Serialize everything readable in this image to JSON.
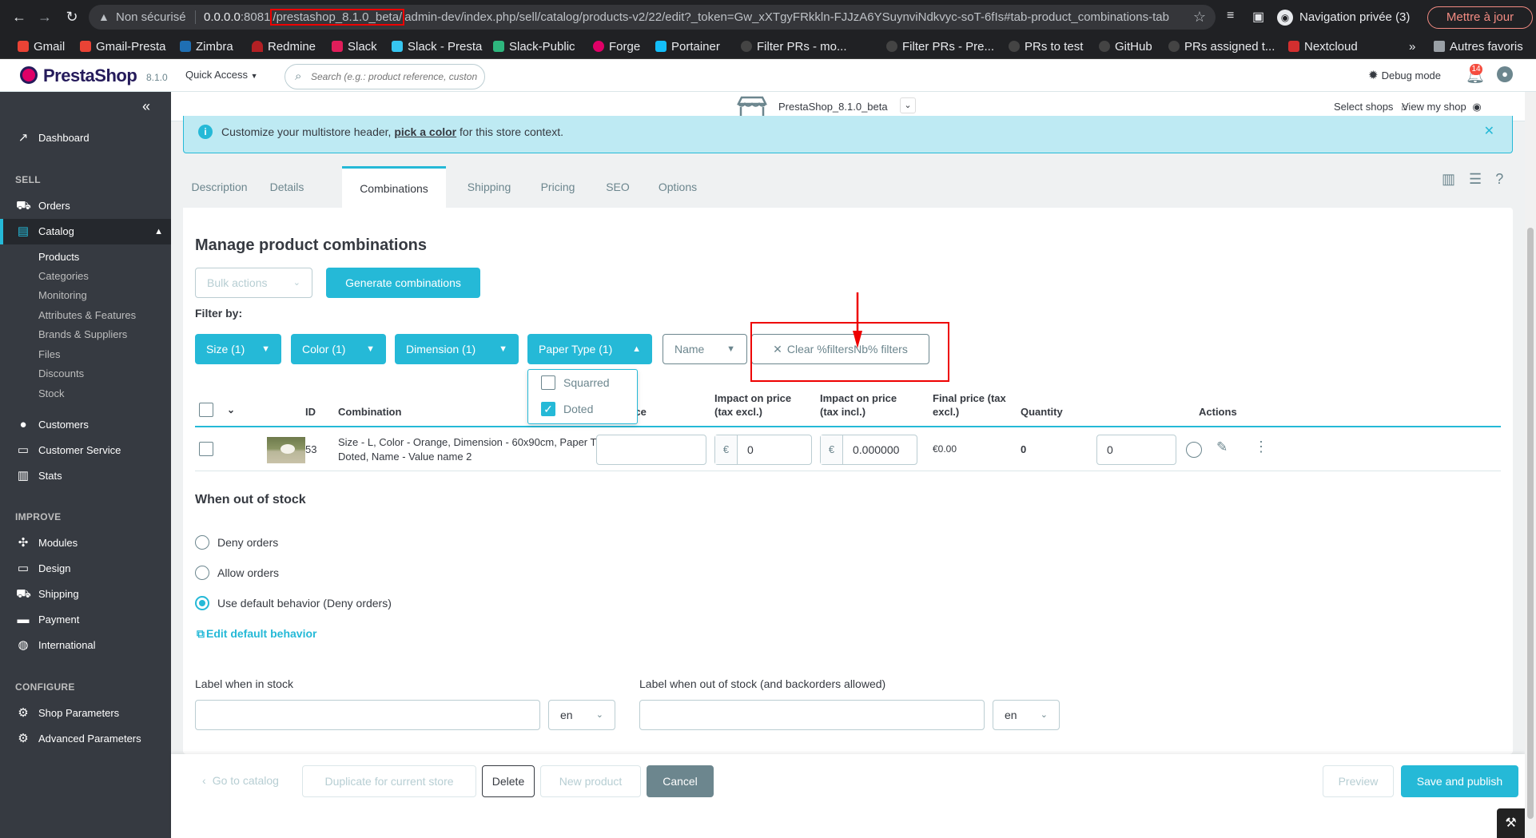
{
  "browser": {
    "not_secure": "Non sécurisé",
    "url_host": "0.0.0.0",
    "url_port": ":8081",
    "url_highlight": "/prestashop_8.1.0_beta/",
    "url_rest": "admin-dev/index.php/sell/catalog/products-v2/22/edit?_token=Gw_xXTgyFRkkln-FJJzA6YSuynviNdkvyc-soT-6fIs#tab-product_combinations-tab",
    "incognito": "Navigation privée (3)",
    "update": "Mettre à jour",
    "bookmarks": [
      "Gmail",
      "Gmail-Presta",
      "Zimbra",
      "Redmine",
      "Slack",
      "Slack - Presta",
      "Slack-Public",
      "Forge",
      "Portainer",
      "Filter PRs - mo...",
      "Filter PRs - Pre...",
      "PRs to test",
      "GitHub",
      "PRs assigned t...",
      "Nextcloud"
    ],
    "more": "»",
    "other_bookmarks": "Autres favoris",
    "colors": {
      "chrome_bg": "#202124",
      "update_accent": "#f28b82"
    }
  },
  "header": {
    "brand": "PrestaShop",
    "version": "8.1.0",
    "quick_access": "Quick Access",
    "search_placeholder": "Search (e.g.: product reference, custon",
    "debug_mode": "Debug mode",
    "notifications_count": "14"
  },
  "sidebar": {
    "dashboard": "Dashboard",
    "sell": "SELL",
    "orders": "Orders",
    "catalog": "Catalog",
    "catalog_sub": [
      "Products",
      "Categories",
      "Monitoring",
      "Attributes & Features",
      "Brands & Suppliers",
      "Files",
      "Discounts",
      "Stock"
    ],
    "customers": "Customers",
    "customer_service": "Customer Service",
    "stats": "Stats",
    "improve": "IMPROVE",
    "modules": "Modules",
    "design": "Design",
    "shipping": "Shipping",
    "payment": "Payment",
    "international": "International",
    "configure": "CONFIGURE",
    "shop_parameters": "Shop Parameters",
    "advanced_parameters": "Advanced Parameters"
  },
  "storebar": {
    "store_name": "PrestaShop_8.1.0_beta",
    "select_shops": "Select shops",
    "view_my_shop": "View my shop"
  },
  "alert": {
    "before": "Customize your multistore header, ",
    "link": "pick a color",
    "after": " for this store context."
  },
  "tabs": [
    "Description",
    "Details",
    "Combinations",
    "Shipping",
    "Pricing",
    "SEO",
    "Options"
  ],
  "combinations": {
    "title": "Manage product combinations",
    "bulk_actions": "Bulk actions",
    "generate": "Generate combinations",
    "filter_by": "Filter by:",
    "filters": [
      "Size (1)",
      "Color (1)",
      "Dimension (1)",
      "Paper Type (1)",
      "Name"
    ],
    "clear_filters": "Clear %filtersNb% filters",
    "paper_type_options": [
      {
        "label": "Squarred",
        "checked": false
      },
      {
        "label": "Doted",
        "checked": true
      }
    ],
    "columns": {
      "id": "ID",
      "combination": "Combination",
      "reference": "Reference",
      "impact_excl_1": "Impact on price",
      "impact_excl_2": "(tax excl.)",
      "impact_incl_1": "Impact on price",
      "impact_incl_2": "(tax incl.)",
      "final_1": "Final price (tax",
      "final_2": "excl.)",
      "quantity": "Quantity",
      "actions": "Actions"
    },
    "rows": [
      {
        "id": "53",
        "combination_1": "Size - L, Color - Orange, Dimension - 60x90cm, Paper Type -",
        "combination_2": "Doted, Name - Value name 2",
        "reference": "",
        "currency": "€",
        "impact_excl": "0",
        "impact_incl": "0.000000",
        "final_price": "€0.00",
        "quantity": "0",
        "quantity_input": "0"
      }
    ]
  },
  "out_of_stock": {
    "title": "When out of stock",
    "options": [
      "Deny orders",
      "Allow orders",
      "Use default behavior (Deny orders)"
    ],
    "selected_index": 2,
    "edit_default": "Edit default behavior",
    "label_in_stock": "Label when in stock",
    "label_out_stock": "Label when out of stock (and backorders allowed)",
    "lang": "en"
  },
  "footer": {
    "go_to_catalog": "Go to catalog",
    "duplicate": "Duplicate for current store",
    "delete": "Delete",
    "new_product": "New product",
    "cancel": "Cancel",
    "preview": "Preview",
    "save_publish": "Save and publish"
  },
  "colors": {
    "primary": "#25b9d7",
    "sidebar_bg": "#363a41",
    "annotation": "#ee0000"
  }
}
